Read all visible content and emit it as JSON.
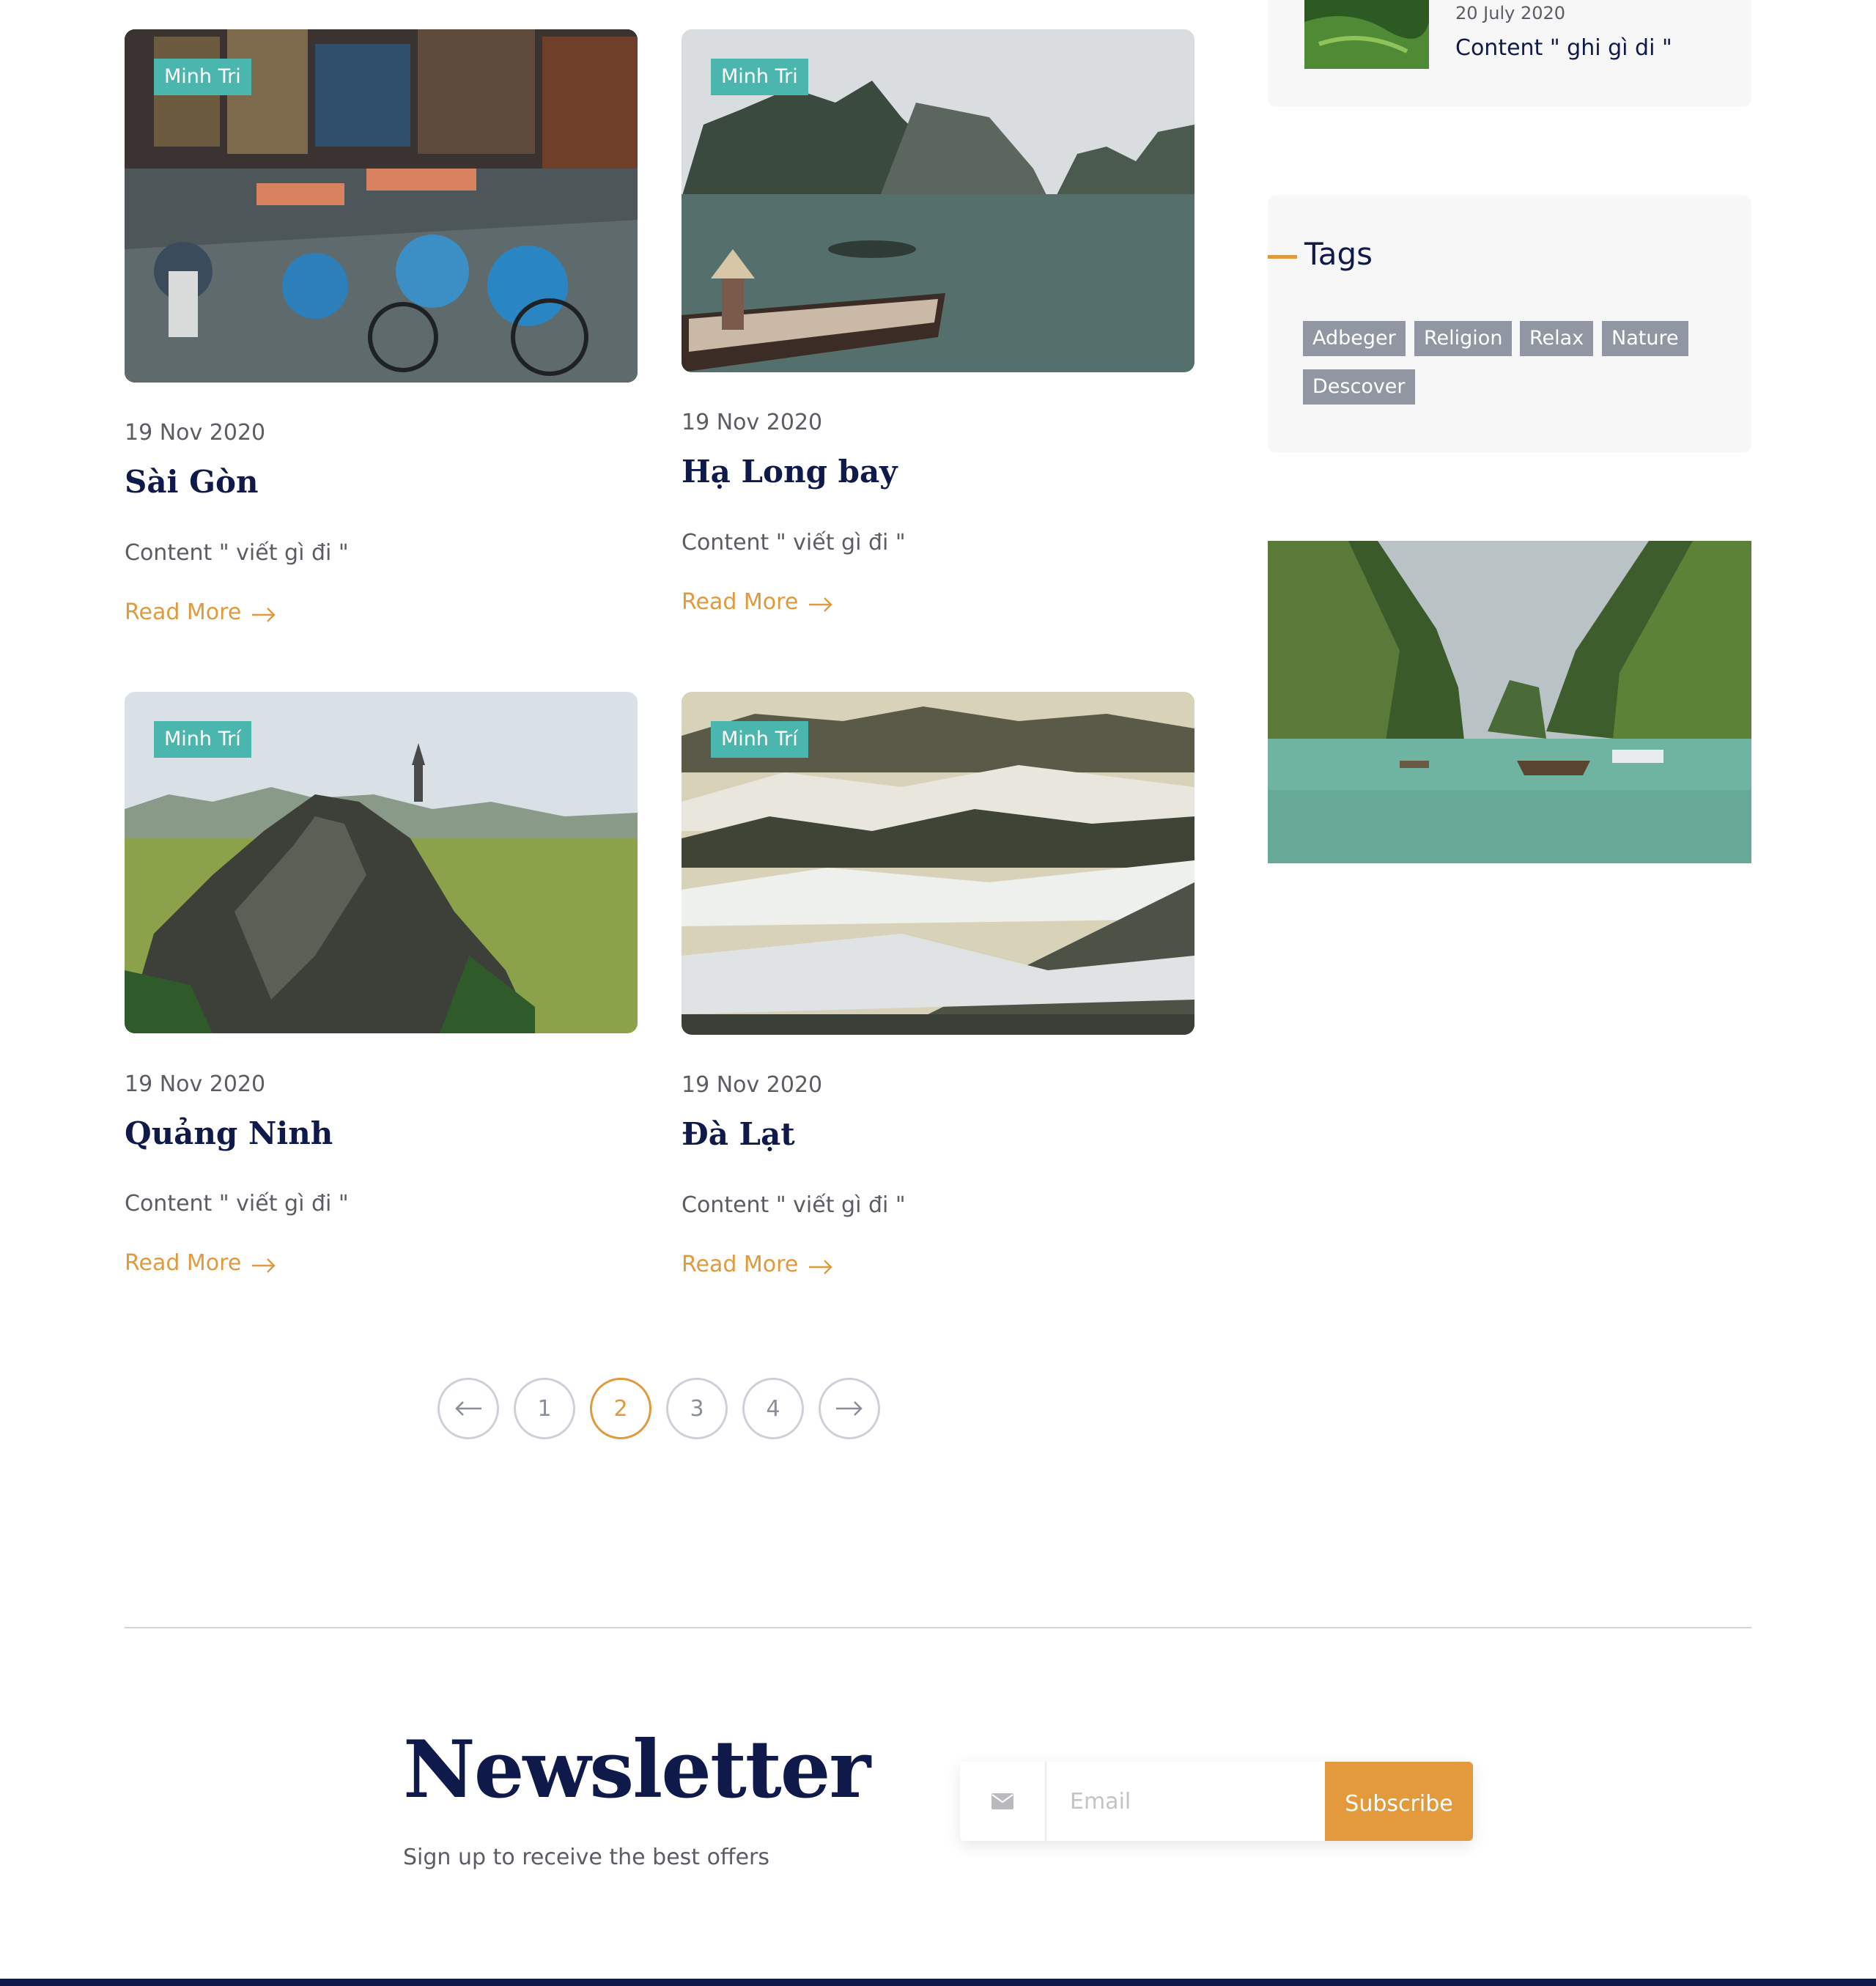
{
  "posts": [
    {
      "author": "Minh Tri",
      "date": "19 Nov 2020",
      "title": "Sài Gòn",
      "excerpt": "Content \" viết gì đi \"",
      "read_more": "Read More"
    },
    {
      "author": "Minh Tri",
      "date": "19 Nov 2020",
      "title": "Hạ Long bay",
      "excerpt": "Content \" viết gì đi \"",
      "read_more": "Read More"
    },
    {
      "author": "Minh Trí",
      "date": "19 Nov 2020",
      "title": "Quảng Ninh",
      "excerpt": "Content \" viết gì đi \"",
      "read_more": "Read More"
    },
    {
      "author": "Minh Trí",
      "date": "19 Nov 2020",
      "title": "Đà Lạt",
      "excerpt": "Content \" viết gì đi \"",
      "read_more": "Read More"
    }
  ],
  "sidebar": {
    "recent_post": {
      "date": "20 July 2020",
      "title": "Content \" ghi gì di \""
    },
    "tags_title": "Tags",
    "tags": [
      "Adbeger",
      "Religion",
      "Relax",
      "Nature",
      "Descover"
    ]
  },
  "pagination": {
    "pages": [
      "1",
      "2",
      "3",
      "4"
    ],
    "active": "2"
  },
  "newsletter": {
    "title": "Newsletter",
    "subtitle": "Sign up to receive the best offers",
    "email_placeholder": "Email",
    "subscribe_label": "Subscribe"
  },
  "colors": {
    "accent": "#df9a3e",
    "navy": "#0f1a4a",
    "author_tag": "#4bb6ae",
    "tag_chip": "#9097a3",
    "footer": "#0f1a4a"
  },
  "icons": {
    "read_more": "arrow-right-icon",
    "prev": "arrow-left-icon",
    "next": "arrow-right-icon",
    "email": "envelope-icon"
  }
}
